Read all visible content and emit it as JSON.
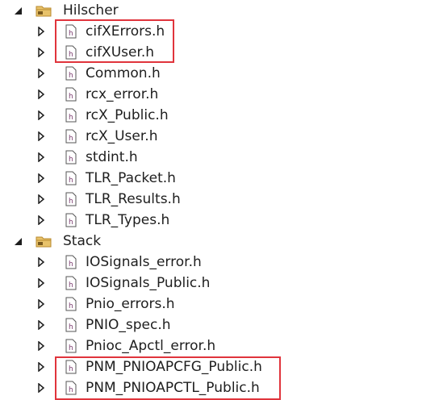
{
  "colors": {
    "highlight": "#e0343c",
    "text": "#1e1e1e",
    "folder": "#d9a441",
    "file_icon_accent": "#7a3b6e"
  },
  "tree": {
    "hilscher": {
      "label": "Hilscher",
      "icon": "folder-icon",
      "expanded": true,
      "files": [
        {
          "label": "cifXErrors.h",
          "icon": "header-file-icon"
        },
        {
          "label": "cifXUser.h",
          "icon": "header-file-icon"
        },
        {
          "label": "Common.h",
          "icon": "header-file-icon"
        },
        {
          "label": "rcx_error.h",
          "icon": "header-file-icon"
        },
        {
          "label": "rcX_Public.h",
          "icon": "header-file-icon"
        },
        {
          "label": "rcX_User.h",
          "icon": "header-file-icon"
        },
        {
          "label": "stdint.h",
          "icon": "header-file-icon"
        },
        {
          "label": "TLR_Packet.h",
          "icon": "header-file-icon"
        },
        {
          "label": "TLR_Results.h",
          "icon": "header-file-icon"
        },
        {
          "label": "TLR_Types.h",
          "icon": "header-file-icon"
        }
      ]
    },
    "stack": {
      "label": "Stack",
      "icon": "folder-icon",
      "expanded": true,
      "files": [
        {
          "label": "IOSignals_error.h",
          "icon": "header-file-icon"
        },
        {
          "label": "IOSignals_Public.h",
          "icon": "header-file-icon"
        },
        {
          "label": "Pnio_errors.h",
          "icon": "header-file-icon"
        },
        {
          "label": "PNIO_spec.h",
          "icon": "header-file-icon"
        },
        {
          "label": "Pnioc_Apctl_error.h",
          "icon": "header-file-icon"
        },
        {
          "label": "PNM_PNIOAPCFG_Public.h",
          "icon": "header-file-icon"
        },
        {
          "label": "PNM_PNIOAPCTL_Public.h",
          "icon": "header-file-icon"
        }
      ]
    }
  }
}
